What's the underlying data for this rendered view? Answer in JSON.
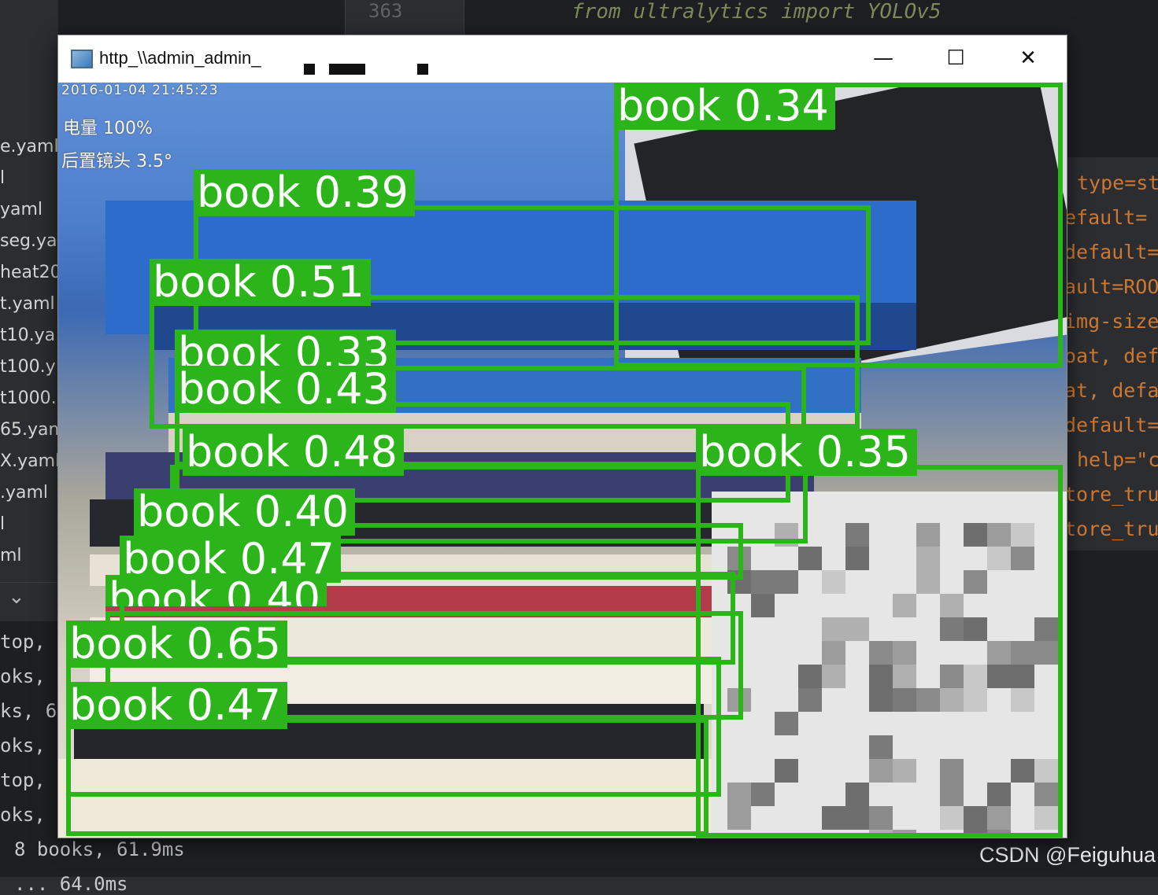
{
  "ide": {
    "line_number": "363",
    "code_top": "from ultralytics import YOLOv5",
    "left_files": [
      "e.yaml",
      "l",
      "yaml",
      "seg.ya",
      "heat20",
      "t.yaml",
      "t10.ya",
      "t100.y",
      "t1000.",
      "65.yam",
      "X.yaml",
      ".yaml",
      "l",
      "ml"
    ],
    "right_code": [
      "type=st",
      "efault=",
      "default=",
      "ault=ROO",
      "img-size",
      "oat, def",
      "at, defa",
      "default=",
      "help=\"c",
      "tore_tru",
      "tore_tru"
    ],
    "console_lines": [
      "top,",
      "oks,",
      "ks, 6",
      "oks,",
      "top,",
      "oks,",
      "8 books, 61.9ms",
      "... 64.0ms"
    ],
    "watermark": "CSDN @Feiguhua"
  },
  "window": {
    "title": "http_\\\\admin_admin_",
    "controls": {
      "minimize": "—",
      "maximize": "☐",
      "close": "✕"
    }
  },
  "overlay": {
    "timestamp": "2016-01-04 21:45:23",
    "line2": "电量 100%",
    "line3": "后置镜头 3.5°"
  },
  "detections": [
    {
      "label": "book 0.34"
    },
    {
      "label": "book 0.39"
    },
    {
      "label": "book 0.51"
    },
    {
      "label": "book 0.33"
    },
    {
      "label": "book 0.43"
    },
    {
      "label": "book 0.48"
    },
    {
      "label": "book 0.35"
    },
    {
      "label": "book 0.40"
    },
    {
      "label": "book 0.47"
    },
    {
      "label": "book 0.40"
    },
    {
      "label": "book 0.65"
    },
    {
      "label": "book 0.47"
    }
  ],
  "colors": {
    "box": "#2bb51a",
    "ide_bg": "#1e1f22"
  }
}
